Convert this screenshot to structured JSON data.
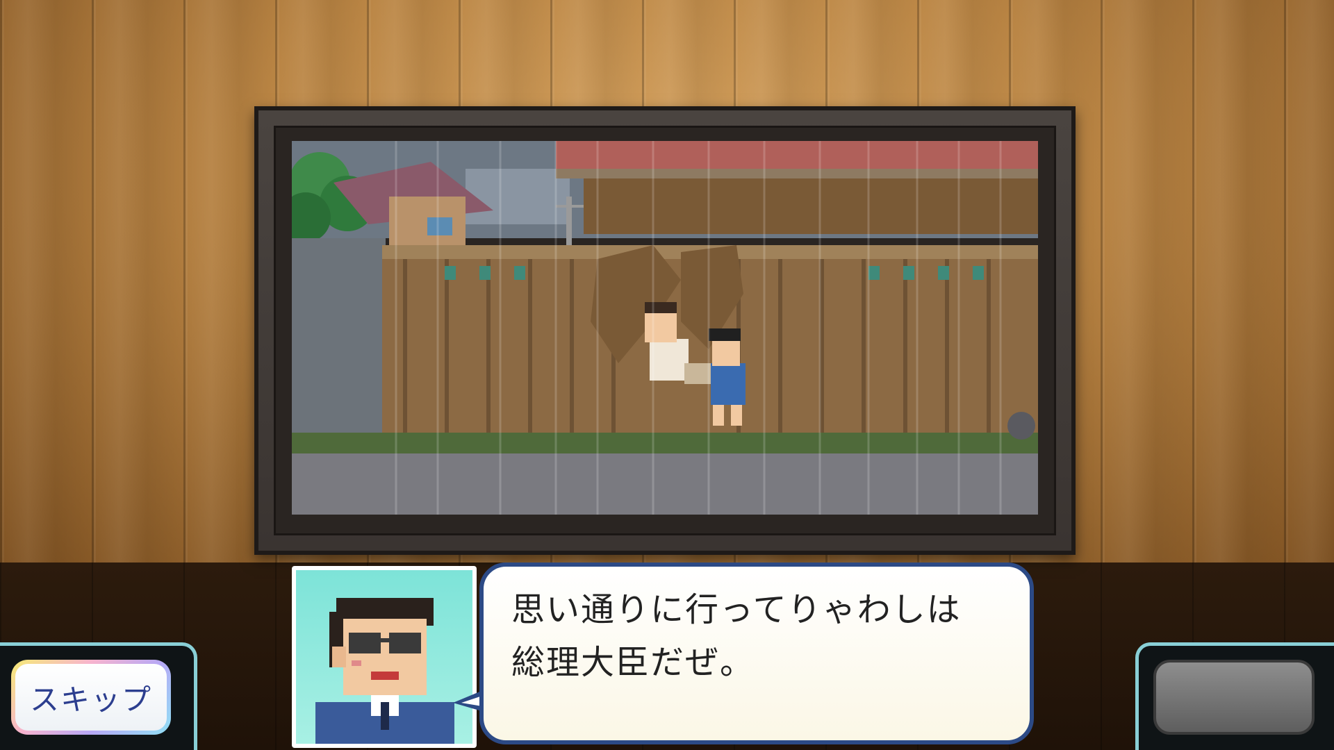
{
  "dialogue": {
    "text": "思い通りに行ってりゃわしは\n総理大臣だぜ。"
  },
  "skip_button": {
    "label": "スキップ"
  },
  "colors": {
    "bubble_border": "#2c4a86",
    "panel_border": "#89cfd6",
    "portrait_bg": "#7de3d8",
    "skip_text": "#2c3e8f"
  }
}
